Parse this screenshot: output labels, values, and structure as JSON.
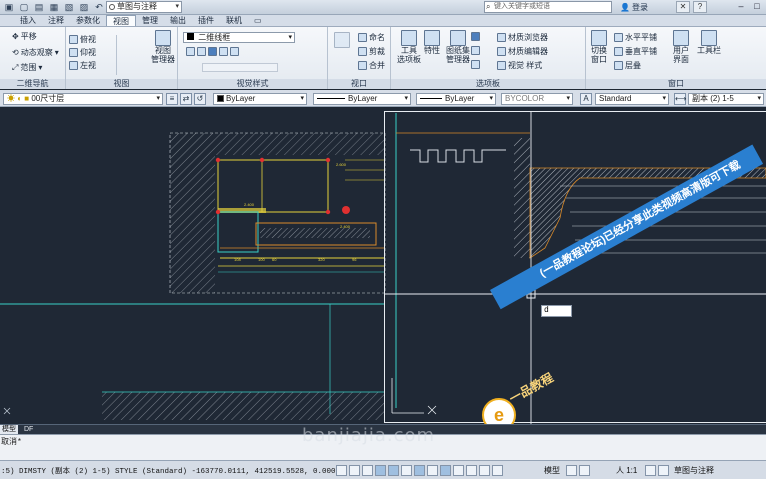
{
  "titlebar": {
    "workspace": "草图与注释",
    "search_placeholder": "键入关键字或短语",
    "signin": "登录"
  },
  "tabs": [
    "",
    "插入",
    "注释",
    "参数化",
    "视图",
    "管理",
    "输出",
    "插件",
    "联机",
    ""
  ],
  "ribbon": {
    "nav_panel": {
      "items": [
        "平移",
        "动态观察",
        "范围"
      ],
      "title": "二维导航"
    },
    "views_panel": {
      "items": [
        "俯视",
        "仰视",
        "左视"
      ],
      "manager": "视图\n管理器",
      "title": "视图"
    },
    "visual_styles_panel": {
      "style": "二维线框",
      "title": "视觉样式"
    },
    "viewports_panel": {
      "items": [
        "命名",
        "剪裁",
        "合并"
      ],
      "title": "视口"
    },
    "palettes_panel": {
      "items": [
        "工具\n选项板",
        "特性",
        "图纸集\n管理器",
        "材质浏览器",
        "材质编辑器",
        "视觉  样式"
      ],
      "title": "选项板"
    },
    "windows_panel": {
      "items": [
        "切换\n窗口",
        "水平平铺",
        "垂直平铺",
        "层叠",
        "用户\n界面",
        "工具栏"
      ],
      "title": "窗口"
    }
  },
  "properties_toolbar": {
    "layer": "00尺寸层",
    "color": "ByLayer",
    "linetype": "ByLayer",
    "lineweight": "ByLayer",
    "plotstyle": "BYCOLOR",
    "textstyle": "Standard",
    "dimstyle": "副本 (2) 1-5"
  },
  "drawing": {
    "dims_row": [
      "108",
      "100",
      "60",
      "320",
      "96"
    ],
    "dims_top": [
      "2.600",
      "2.400",
      "2.400"
    ],
    "dyn_input": "d"
  },
  "watermark": {
    "banner": "(一品教程论坛)已经分享此类视频高清版可下载",
    "logo_text": "一品教程",
    "site": "banjiajia.com"
  },
  "layout_tabs": [
    "模型",
    "DF"
  ],
  "command": {
    "history": "取消*"
  },
  "status": {
    "coords": ":5) DIMSTY (副本 (2) 1-5) STYLE (Standard)  -163770.0111, 412519.5528, 0.0000",
    "model": "模型",
    "scale": "人 1:1",
    "workspace": "草图与注释"
  },
  "colors": {
    "canvas": "#1f2835",
    "cyan": "#38d0c6",
    "yellow": "#e6d23c",
    "orange": "#d98a2a",
    "red": "#e03030",
    "white_hatch": "#dfe4ea"
  }
}
